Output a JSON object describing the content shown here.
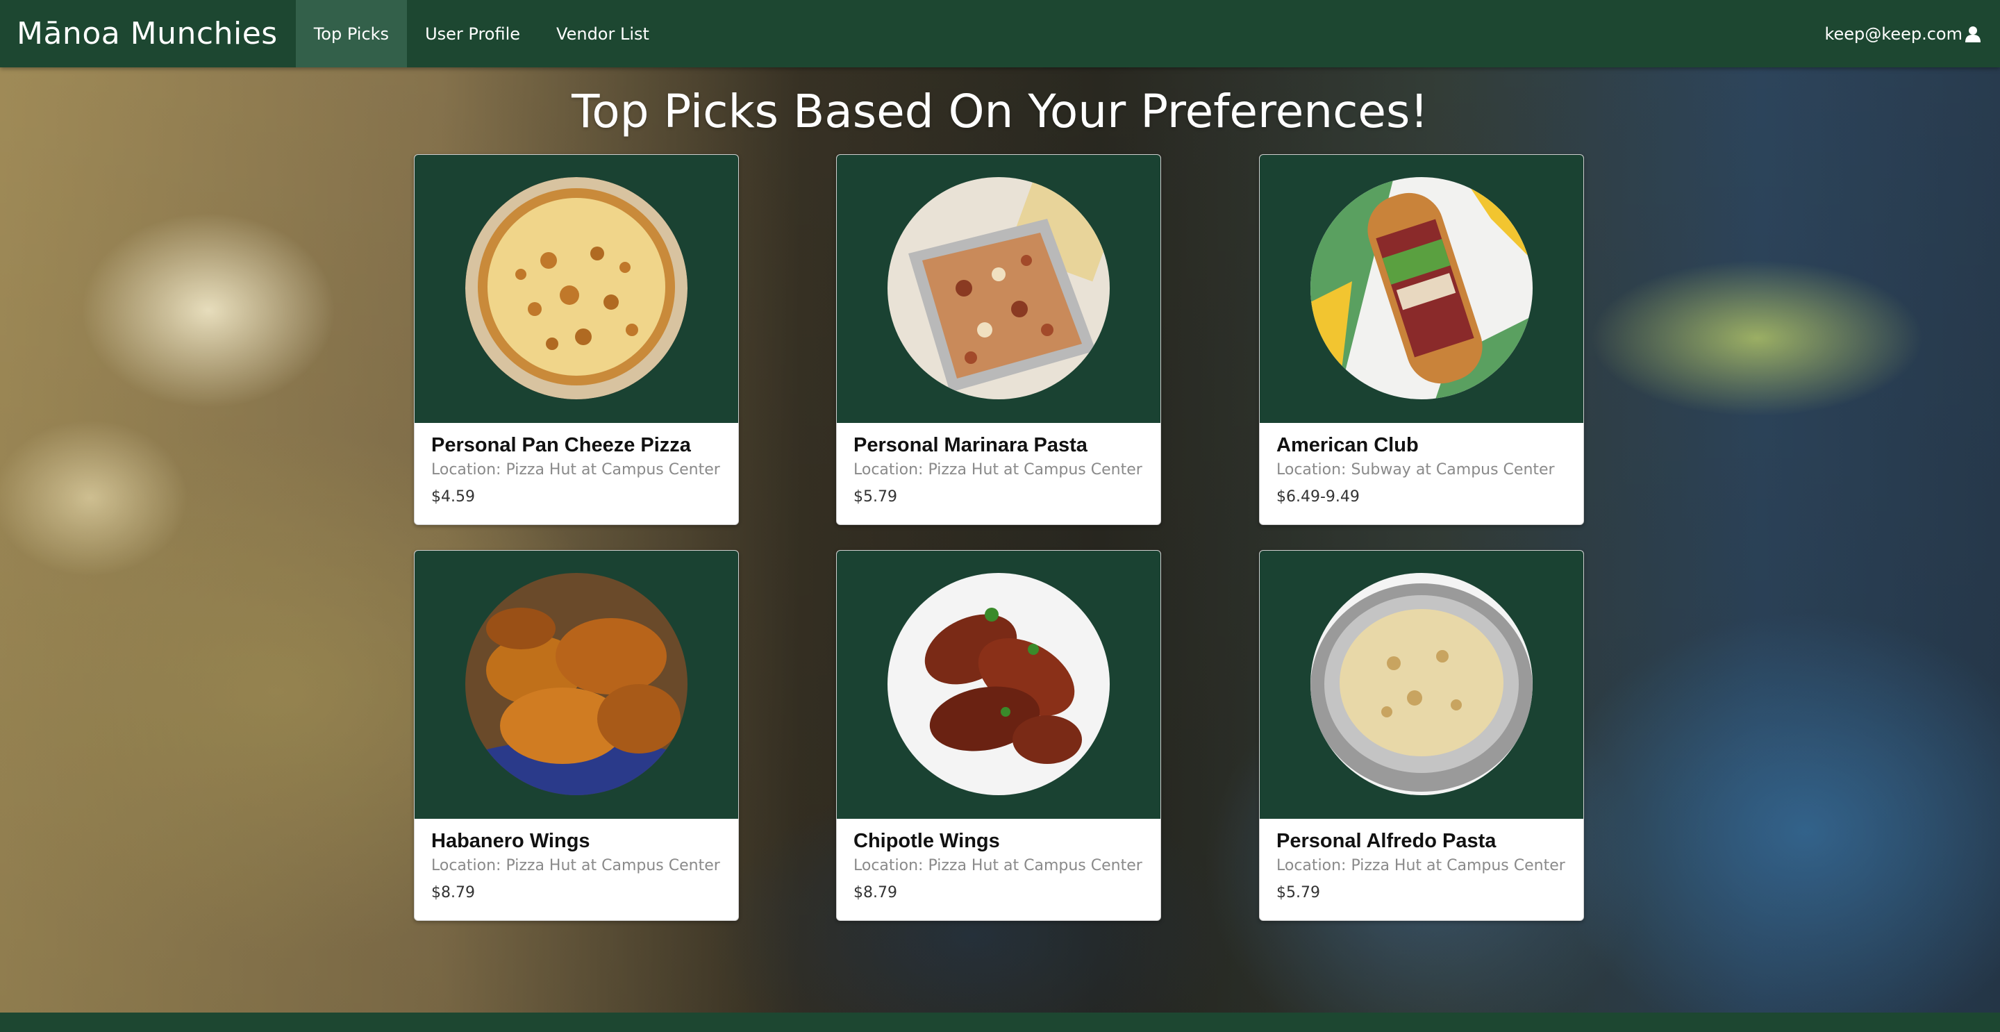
{
  "navbar": {
    "brand": "Mānoa Munchies",
    "items": [
      {
        "label": "Top Picks",
        "active": true
      },
      {
        "label": "User Profile",
        "active": false
      },
      {
        "label": "Vendor List",
        "active": false
      }
    ],
    "user_email": "keep@keep.com",
    "user_icon": "user-icon"
  },
  "page": {
    "title": "Top Picks Based On Your Preferences!"
  },
  "cards": [
    {
      "name": "Personal Pan Cheeze Pizza",
      "location": "Location: Pizza Hut at Campus Center",
      "price": "$4.59",
      "image": "pizza"
    },
    {
      "name": "Personal Marinara Pasta",
      "location": "Location: Pizza Hut at Campus Center",
      "price": "$5.79",
      "image": "pasta-tray"
    },
    {
      "name": "American Club",
      "location": "Location: Subway at Campus Center",
      "price": "$6.49-9.49",
      "image": "sandwich"
    },
    {
      "name": "Habanero Wings",
      "location": "Location: Pizza Hut at Campus Center",
      "price": "$8.79",
      "image": "wings"
    },
    {
      "name": "Chipotle Wings",
      "location": "Location: Pizza Hut at Campus Center",
      "price": "$8.79",
      "image": "grilled-wings"
    },
    {
      "name": "Personal Alfredo Pasta",
      "location": "Location: Pizza Hut at Campus Center",
      "price": "$5.79",
      "image": "alfredo-pan"
    }
  ],
  "colors": {
    "navbar": "#1d4731",
    "navbar_active": "#33604a",
    "card_image_bg": "#1a4232"
  }
}
